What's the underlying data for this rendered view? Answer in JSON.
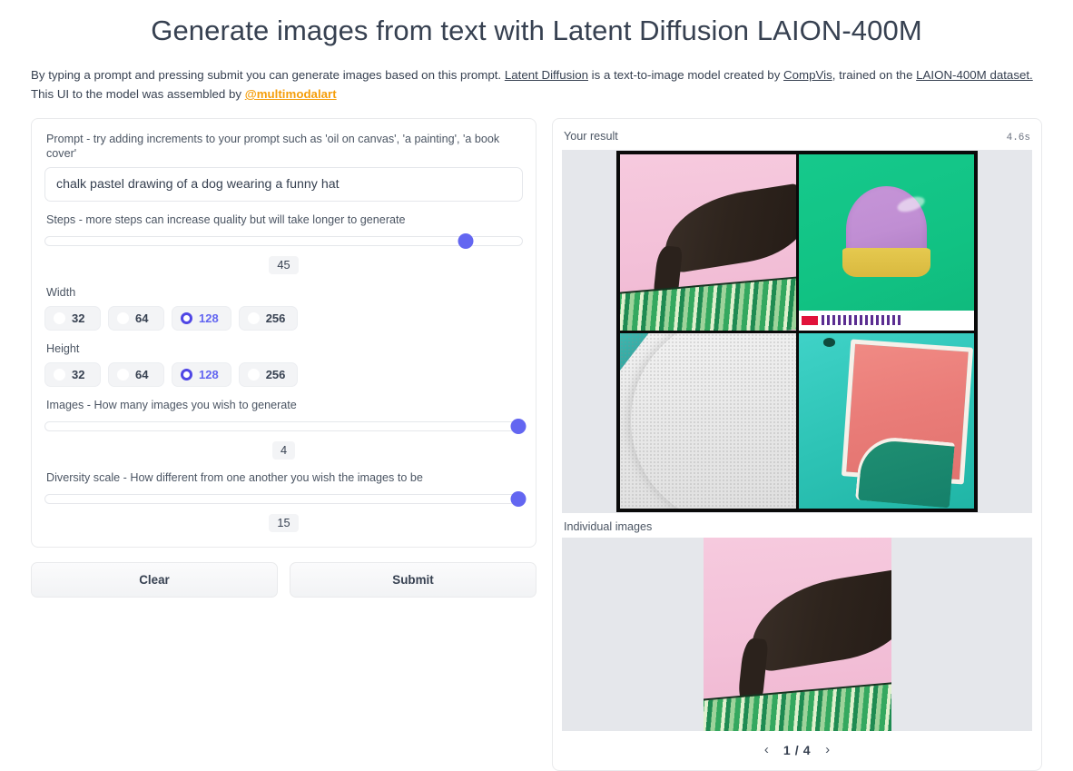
{
  "header": {
    "title": "Generate images from text with Latent Diffusion LAION-400M",
    "intro_part1": "By typing a prompt and pressing submit you can generate images based on this prompt. ",
    "link_latent_diffusion": "Latent Diffusion",
    "intro_part2": " is a text-to-image model created by ",
    "link_compvis": "CompVis",
    "intro_part3": ", trained on the ",
    "link_laion": "LAION-400M dataset.",
    "intro_line2_prefix": "This UI to the model was assembled by ",
    "link_author": "@multimodalart"
  },
  "controls": {
    "prompt": {
      "label": "Prompt - try adding increments to your prompt such as 'oil on canvas', 'a painting', 'a book cover'",
      "value": "chalk pastel drawing of a dog wearing a funny hat",
      "placeholder": ""
    },
    "steps": {
      "label": "Steps - more steps can increase quality but will take longer to generate",
      "value": "45",
      "fill_percent": 88
    },
    "width": {
      "label": "Width",
      "options": [
        "32",
        "64",
        "128",
        "256"
      ],
      "selected": "128"
    },
    "height": {
      "label": "Height",
      "options": [
        "32",
        "64",
        "128",
        "256"
      ],
      "selected": "128"
    },
    "images": {
      "label": "Images - How many images you wish to generate",
      "value": "4",
      "fill_percent": 99
    },
    "diversity": {
      "label": "Diversity scale - How different from one another you wish the images to be",
      "value": "15",
      "fill_percent": 99
    },
    "clear_label": "Clear",
    "submit_label": "Submit"
  },
  "result": {
    "title": "Your result",
    "time": "4.6s",
    "individual_title": "Individual images",
    "pager": {
      "prev_icon": "‹",
      "next_icon": "›",
      "count": "1 / 4"
    }
  },
  "colors": {
    "accent_purple": "#6366f1",
    "accent_indigo": "#4f46e5",
    "link_orange": "#f59e0b",
    "gallery_bg": "#e5e7eb",
    "text": "#374151"
  }
}
